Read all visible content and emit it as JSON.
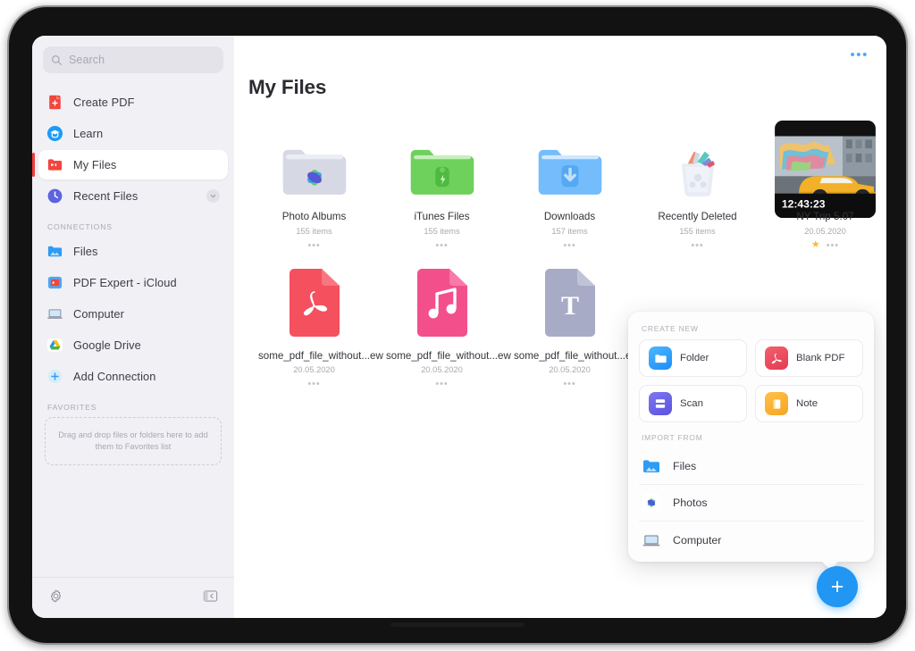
{
  "search": {
    "placeholder": "Search",
    "icon": "search-icon"
  },
  "sidebar": {
    "nav": [
      {
        "label": "Create PDF",
        "icon": "create-pdf-icon"
      },
      {
        "label": "Learn",
        "icon": "learn-icon"
      },
      {
        "label": "My Files",
        "icon": "my-files-icon",
        "selected": true
      },
      {
        "label": "Recent Files",
        "icon": "recent-files-clock-icon",
        "chevron": "chevron-down-icon"
      }
    ],
    "connections_header": "CONNECTIONS",
    "connections": [
      {
        "label": "Files",
        "icon": "files-folder-icon"
      },
      {
        "label": "PDF Expert - iCloud",
        "icon": "pdf-expert-icloud-icon"
      },
      {
        "label": "Computer",
        "icon": "computer-laptop-icon"
      },
      {
        "label": "Google Drive",
        "icon": "google-drive-icon"
      },
      {
        "label": "Add Connection",
        "icon": "plus-circle-icon"
      }
    ],
    "favorites_header": "FAVORITES",
    "favorites_empty": "Drag and drop files or folders here to add them to Favorites list",
    "footer": {
      "settings_icon": "gear-icon",
      "collapse_icon": "collapse-sidebar-icon"
    }
  },
  "main": {
    "title": "My Files",
    "more_label": "•••",
    "items": [
      {
        "name": "Photo Albums",
        "sub": "155 items",
        "icon": "photo-albums-folder-icon",
        "starred": false
      },
      {
        "name": "iTunes Files",
        "sub": "155 items",
        "icon": "itunes-files-folder-icon",
        "starred": false
      },
      {
        "name": "Downloads",
        "sub": "157 items",
        "icon": "downloads-folder-icon",
        "starred": false
      },
      {
        "name": "Recently Deleted",
        "sub": "155 items",
        "icon": "recently-deleted-trash-icon",
        "starred": false
      },
      {
        "name": "NY Trip 5.07",
        "sub": "20.05.2020",
        "icon": "video-thumbnail",
        "duration": "12:43:23",
        "starred": true
      },
      {
        "name": "some_pdf_file_without...ew",
        "sub": "20.05.2020",
        "icon": "pdf-file-icon",
        "starred": false
      },
      {
        "name": "some_pdf_file_without...ew",
        "sub": "20.05.2020",
        "icon": "audio-file-icon",
        "starred": false
      },
      {
        "name": "some_pdf_file_without...ew",
        "sub": "20.05.2020",
        "icon": "text-file-icon",
        "starred": false
      }
    ]
  },
  "popover": {
    "create_new_header": "CREATE NEW",
    "create_new": [
      {
        "label": "Folder",
        "icon": "folder-icon"
      },
      {
        "label": "Blank PDF",
        "icon": "blank-pdf-icon"
      },
      {
        "label": "Scan",
        "icon": "scan-icon"
      },
      {
        "label": "Note",
        "icon": "note-icon"
      }
    ],
    "import_from_header": "IMPORT FROM",
    "import_from": [
      {
        "label": "Files",
        "icon": "files-folder-icon"
      },
      {
        "label": "Photos",
        "icon": "photos-icon"
      },
      {
        "label": "Computer",
        "icon": "computer-laptop-icon"
      }
    ]
  },
  "fab": {
    "label": "+",
    "icon": "plus-icon",
    "color": "#2196f3"
  },
  "colors": {
    "accent": "#2196f3",
    "sidebar_bg": "#f1f0f5",
    "selected_bar": "#f03e3e",
    "star": "#ffb829"
  }
}
